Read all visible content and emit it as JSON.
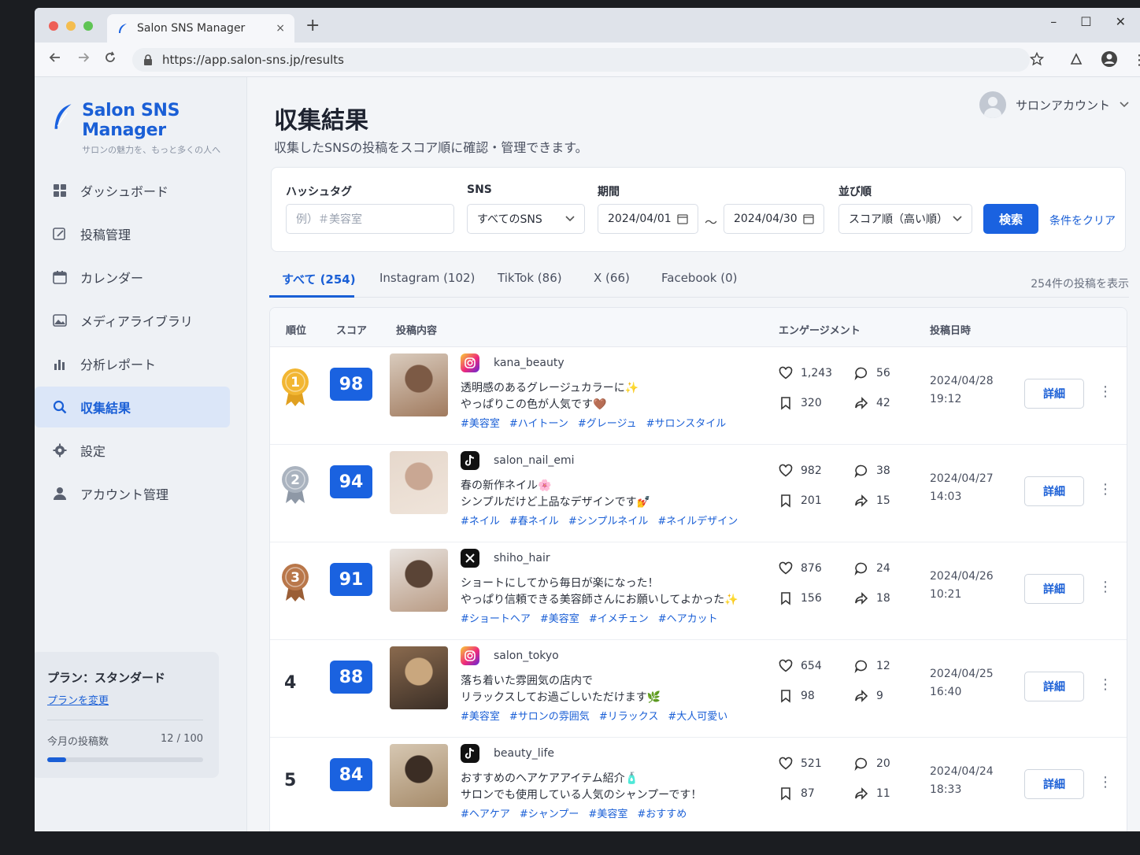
{
  "browser": {
    "tab_title": "Salon SNS Manager",
    "tab_close": "×",
    "new_tab": "+",
    "url": "https://app.salon-sns.jp/results",
    "win_min": "–",
    "win_max": "☐",
    "win_close": "✕"
  },
  "brand": {
    "name": "Salon SNS Manager",
    "tagline": "サロンの魅力を、もっと多くの人へ"
  },
  "sidebar": {
    "items": [
      {
        "label": "ダッシュボード",
        "icon": "dashboard-icon"
      },
      {
        "label": "投稿管理",
        "icon": "edit-icon"
      },
      {
        "label": "カレンダー",
        "icon": "calendar-icon"
      },
      {
        "label": "メディアライブラリ",
        "icon": "image-icon"
      },
      {
        "label": "分析レポート",
        "icon": "bar-chart-icon"
      },
      {
        "label": "収集結果",
        "icon": "search-icon",
        "active": true
      },
      {
        "label": "設定",
        "icon": "gear-icon"
      },
      {
        "label": "アカウント管理",
        "icon": "user-icon"
      }
    ],
    "plan": {
      "title": "プラン：スタンダード",
      "change_link": "プランを変更",
      "usage_label": "今月の投稿数",
      "usage_value": "12 / 100",
      "usage_fraction": 0.12
    }
  },
  "header": {
    "title": "収集結果",
    "subtitle": "収集したSNSの投稿をスコア順に確認・管理できます。",
    "account_name": "サロンアカウント"
  },
  "filters": {
    "hashtag_label": "ハッシュタグ",
    "hashtag_placeholder": "例）＃美容室",
    "sns_label": "SNS",
    "sns_value": "すべてのSNS",
    "period_label": "期間",
    "date_from": "2024/04/01",
    "date_to": "2024/04/30",
    "tilde": "〜",
    "sort_label": "並び順",
    "sort_value": "スコア順（高い順）",
    "search_button": "検索",
    "clear_link": "条件をクリア"
  },
  "tabs": [
    {
      "label": "すべて (254)",
      "active": true
    },
    {
      "label": "Instagram (102)"
    },
    {
      "label": "TikTok (86)"
    },
    {
      "label": "X (66)"
    },
    {
      "label": "Facebook (0)"
    }
  ],
  "result_count": "254件の投稿を表示",
  "table": {
    "headers": {
      "rank": "順位",
      "score": "スコア",
      "content": "投稿内容",
      "engagement": "エンゲージメント",
      "date": "投稿日時"
    },
    "detail_label": "詳細",
    "kebab": "⋮",
    "rows": [
      {
        "rank": "1",
        "medal": "gold",
        "score": "98",
        "platform": "instagram",
        "user": "kana_beauty",
        "line1": "透明感のあるグレージュカラーに✨",
        "line2": "やっぱりこの色が人気です🤎",
        "tags": [
          "#美容室",
          "#ハイトーン",
          "#グレージュ",
          "#サロンスタイル"
        ],
        "likes": "1,243",
        "comments": "56",
        "saves": "320",
        "shares": "42",
        "date": "2024/04/28",
        "time": "19:12"
      },
      {
        "rank": "2",
        "medal": "silver",
        "score": "94",
        "platform": "tiktok",
        "user": "salon_nail_emi",
        "line1": "春の新作ネイル🌸",
        "line2": "シンプルだけど上品なデザインです💅",
        "tags": [
          "#ネイル",
          "#春ネイル",
          "#シンプルネイル",
          "#ネイルデザイン"
        ],
        "likes": "982",
        "comments": "38",
        "saves": "201",
        "shares": "15",
        "date": "2024/04/27",
        "time": "14:03"
      },
      {
        "rank": "3",
        "medal": "bronze",
        "score": "91",
        "platform": "x",
        "user": "shiho_hair",
        "line1": "ショートにしてから毎日が楽になった！",
        "line2": "やっぱり信頼できる美容師さんにお願いしてよかった✨",
        "tags": [
          "#ショートヘア",
          "#美容室",
          "#イメチェン",
          "#ヘアカット"
        ],
        "likes": "876",
        "comments": "24",
        "saves": "156",
        "shares": "18",
        "date": "2024/04/26",
        "time": "10:21"
      },
      {
        "rank": "4",
        "medal": "",
        "score": "88",
        "platform": "instagram",
        "user": "salon_tokyo",
        "line1": "落ち着いた雰囲気の店内で",
        "line2": "リラックスしてお過ごしいただけます🌿",
        "tags": [
          "#美容室",
          "#サロンの雰囲気",
          "#リラックス",
          "#大人可愛い"
        ],
        "likes": "654",
        "comments": "12",
        "saves": "98",
        "shares": "9",
        "date": "2024/04/25",
        "time": "16:40"
      },
      {
        "rank": "5",
        "medal": "",
        "score": "84",
        "platform": "tiktok",
        "user": "beauty_life",
        "line1": "おすすめのヘアケアアイテム紹介🧴",
        "line2": "サロンでも使用している人気のシャンプーです！",
        "tags": [
          "#ヘアケア",
          "#シャンプー",
          "#美容室",
          "#おすすめ"
        ],
        "likes": "521",
        "comments": "20",
        "saves": "87",
        "shares": "11",
        "date": "2024/04/24",
        "time": "18:33"
      }
    ]
  }
}
